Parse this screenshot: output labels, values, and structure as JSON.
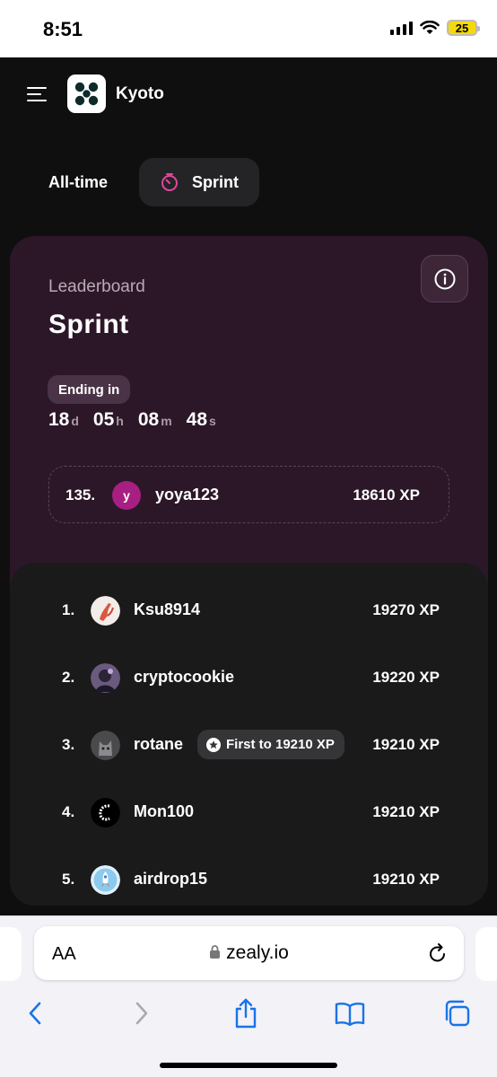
{
  "status_bar": {
    "time": "8:51",
    "battery": "25"
  },
  "header": {
    "brand": "Kyoto"
  },
  "tabs": [
    {
      "label": "All-time",
      "active": false
    },
    {
      "label": "Sprint",
      "active": true
    }
  ],
  "leaderboard": {
    "label": "Leaderboard",
    "title": "Sprint",
    "ending_label": "Ending in",
    "countdown": [
      {
        "value": "18",
        "unit": "d"
      },
      {
        "value": "05",
        "unit": "h"
      },
      {
        "value": "08",
        "unit": "m"
      },
      {
        "value": "48",
        "unit": "s"
      }
    ],
    "current_user": {
      "rank": "135.",
      "initial": "y",
      "name": "yoya123",
      "xp": "18610 XP"
    },
    "entries": [
      {
        "rank": "1.",
        "name": "Ksu8914",
        "xp": "19270 XP",
        "avatar_icon": "hand-avatar"
      },
      {
        "rank": "2.",
        "name": "cryptocookie",
        "xp": "19220 XP",
        "avatar_icon": "portrait-avatar"
      },
      {
        "rank": "3.",
        "name": "rotane",
        "xp": "19210 XP",
        "avatar_icon": "cat-avatar",
        "badge": "First to 19210 XP"
      },
      {
        "rank": "4.",
        "name": "Mon100",
        "xp": "19210 XP",
        "avatar_icon": "ring-avatar"
      },
      {
        "rank": "5.",
        "name": "airdrop15",
        "xp": "19210 XP",
        "avatar_icon": "rocket-avatar"
      }
    ]
  },
  "browser": {
    "aa_label": "AA",
    "url": "zealy.io"
  },
  "colors": {
    "accent": "#a81f82",
    "card_bg": "#2c1729",
    "app_bg": "#0f0f10"
  }
}
